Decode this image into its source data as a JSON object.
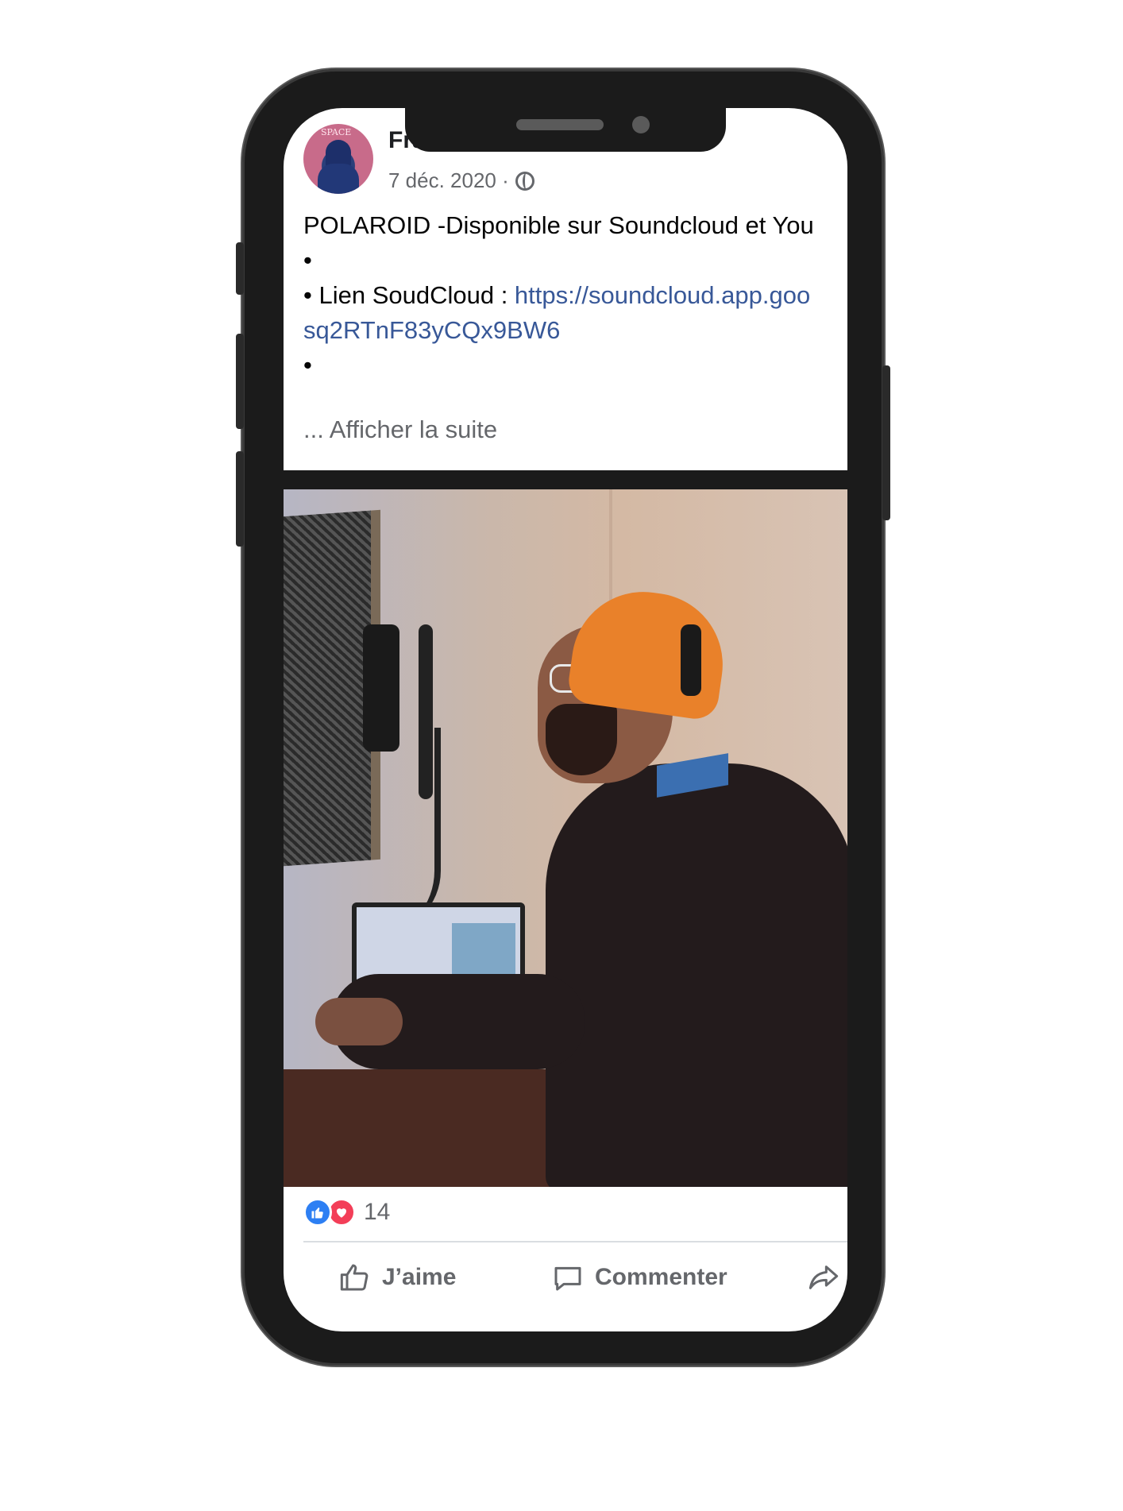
{
  "post": {
    "author": "Frank Guilbault",
    "date": "7 déc. 2020 ·",
    "text_lines": [
      "POLAROID -Disponible sur Soundcloud et You",
      "•"
    ],
    "link_prefix": "• Lien SoudCloud : ",
    "link_part1": "https://soundcloud.app.goo",
    "link_part2": "sq2RTnF83yCQx9BW6",
    "bullet_after": "•",
    "see_more": "... Afficher la suite",
    "avatar_text": "SPACE"
  },
  "reactions": {
    "count": "14"
  },
  "actions": {
    "like": "J’aime",
    "comment": "Commenter"
  },
  "colors": {
    "link": "#385898",
    "like_blue": "#2d7ff3",
    "love_red": "#f33e58",
    "beanie": "#e9812a"
  },
  "icons": [
    "globe-icon",
    "like-reaction-icon",
    "love-reaction-icon",
    "thumbs-up-icon",
    "comment-icon",
    "share-icon"
  ]
}
